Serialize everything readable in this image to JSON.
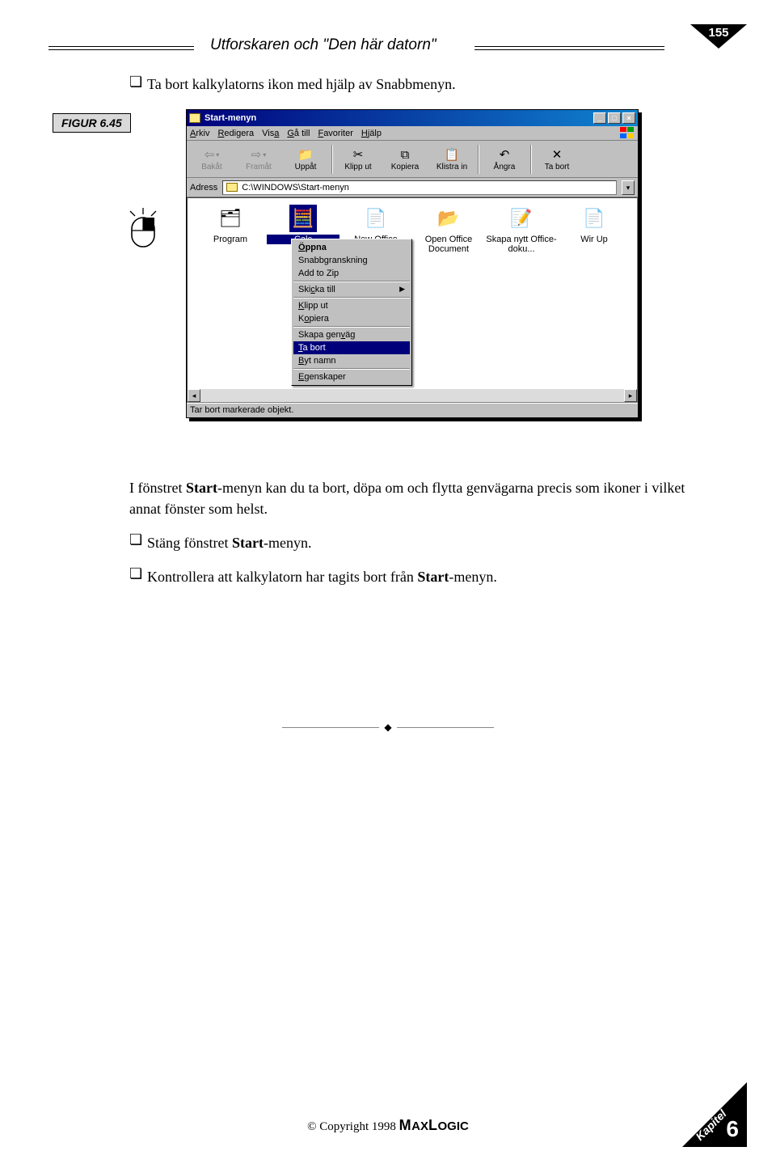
{
  "header": {
    "title": "Utforskaren och \"Den här datorn\"",
    "page_number": "155"
  },
  "figure_label": "FIGUR 6.45",
  "intro_bullet": "Ta bort kalkylatorns ikon med hjälp av Snabbmenyn.",
  "window": {
    "title": "Start-menyn",
    "menubar": [
      "Arkiv",
      "Redigera",
      "Visa",
      "Gå till",
      "Favoriter",
      "Hjälp"
    ],
    "toolbar": [
      {
        "label": "Bakåt",
        "enabled": false,
        "glyph": "⇦",
        "dropdown": true
      },
      {
        "label": "Framåt",
        "enabled": false,
        "glyph": "⇨",
        "dropdown": true
      },
      {
        "label": "Uppåt",
        "enabled": true,
        "glyph": "⇧"
      },
      {
        "label": "Klipp ut",
        "enabled": true,
        "glyph": "✂"
      },
      {
        "label": "Kopiera",
        "enabled": true,
        "glyph": "⧉"
      },
      {
        "label": "Klistra in",
        "enabled": true,
        "glyph": "📋"
      },
      {
        "label": "Ångra",
        "enabled": true,
        "glyph": "↶"
      },
      {
        "label": "Ta bort",
        "enabled": true,
        "glyph": "✕"
      }
    ],
    "address_label": "Adress",
    "address_value": "C:\\WINDOWS\\Start-menyn",
    "icons": [
      {
        "label": "Program",
        "glyph": "🗂"
      },
      {
        "label": "Calc",
        "glyph": "🧮",
        "selected": true
      },
      {
        "label": "New Office",
        "glyph": "📄"
      },
      {
        "label": "Open Office Document",
        "glyph": "📂"
      },
      {
        "label": "Skapa nytt Office-doku...",
        "glyph": "📝"
      },
      {
        "label": "Wir Up",
        "glyph": "📄"
      }
    ],
    "context_menu": [
      {
        "label": "Öppna",
        "bold": true,
        "u": 0
      },
      {
        "label": "Snabbgranskning"
      },
      {
        "label": "Add to Zip"
      },
      {
        "sep": true
      },
      {
        "label": "Skicka till",
        "u": 3,
        "arrow": true
      },
      {
        "sep": true
      },
      {
        "label": "Klipp ut",
        "u": 0
      },
      {
        "label": "Kopiera",
        "u": 1
      },
      {
        "sep": true
      },
      {
        "label": "Skapa genväg",
        "u": 9
      },
      {
        "label": "Ta bort",
        "u": 0,
        "highlight": true
      },
      {
        "label": "Byt namn",
        "u": 0
      },
      {
        "sep": true
      },
      {
        "label": "Egenskaper",
        "u": 0
      }
    ],
    "status": "Tar bort markerade objekt."
  },
  "para": "I fönstret Start-menyn kan du ta bort, döpa om och flytta genvägarna precis som ikoner i vilket annat fönster som helst.",
  "para_prefix": "I fönstret ",
  "para_bold": "Start",
  "para_suffix": "-menyn kan du ta bort, döpa om och flytta genvägarna precis som ikoner i vilket annat fönster som helst.",
  "bullet2_a": "Stäng fönstret ",
  "bullet2_b": "Start",
  "bullet2_c": "-menyn.",
  "bullet3_a": "Kontrollera att kalkylatorn har tagits bort från ",
  "bullet3_b": "Start",
  "bullet3_c": "-menyn.",
  "footer": {
    "copyright": "© Copyright 1998  ",
    "brand_a": "M",
    "brand_b": "AX",
    "brand_c": "L",
    "brand_d": "OGIC",
    "chapter_label": "Kapitel",
    "chapter_number": "6"
  }
}
